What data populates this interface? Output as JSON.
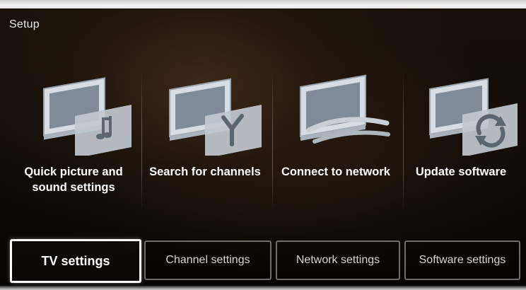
{
  "screen": {
    "title": "Setup"
  },
  "options": [
    {
      "label_line1": "Quick picture and",
      "label_line2": "sound settings",
      "icon": "tv-music-icon"
    },
    {
      "label_line1": "Search for channels",
      "label_line2": "",
      "icon": "tv-antenna-icon"
    },
    {
      "label_line1": "Connect to network",
      "label_line2": "",
      "icon": "tv-network-icon"
    },
    {
      "label_line1": "Update software",
      "label_line2": "",
      "icon": "tv-update-icon"
    }
  ],
  "tabs": [
    {
      "label": "TV settings",
      "selected": true
    },
    {
      "label": "Channel settings",
      "selected": false
    },
    {
      "label": "Network settings",
      "selected": false
    },
    {
      "label": "Software settings",
      "selected": false
    }
  ],
  "colors": {
    "text": "#ffffff",
    "tab_border": "#6d6d6d",
    "selected_tab_border": "#ffffff"
  }
}
